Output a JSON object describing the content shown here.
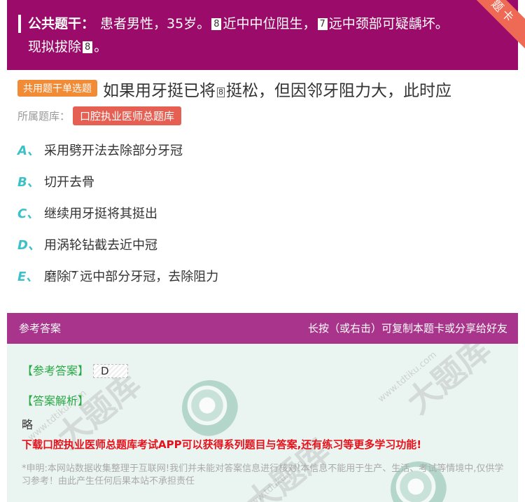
{
  "ribbon": {
    "label": "题卡"
  },
  "stem": {
    "label": "公共题干：",
    "line1_a": "患者男性，35岁。",
    "glyph_8": "8",
    "line1_b": "近中中位阻生，",
    "glyph_7": "7",
    "line1_c": "远中颈部可疑龋坏。",
    "line2_a": "现拟拔除",
    "line2_b": "。"
  },
  "question": {
    "tag": "共用题干单选题",
    "text_a": "如果用牙挺已将",
    "glyph": "8",
    "text_b": "挺松，但因邻牙阻力大，此时应"
  },
  "source": {
    "label": "所属题库：",
    "bank": "口腔执业医师总题库"
  },
  "options": [
    {
      "key": "A、",
      "text": "采用劈开法去除部分牙冠"
    },
    {
      "key": "B、",
      "text": "切开去骨"
    },
    {
      "key": "C、",
      "text": "继续用牙挺将其挺出"
    },
    {
      "key": "D、",
      "text": "用涡轮钻截去近中冠"
    },
    {
      "key": "E、",
      "text_a": "磨除",
      "glyph": "7",
      "text_b": "远中部分牙冠，去除阻力"
    }
  ],
  "answer_panel": {
    "title": "参考答案",
    "hint": "长按（或右击）可复制本题卡或分享给好友",
    "answer_label": "【参考答案】",
    "answer_value": "D",
    "analysis_label": "【答案解析】",
    "analysis_value": "略",
    "promo": "下载口腔执业医师总题库考试APP可以获得系列题目与答案,还有练习等更多学习功能!",
    "disclaimer": "*申明:本网站数据收集整理于互联网!我们并未能对答案信息进行核对!本信息不能用于生产、生活、考试等情境中,仅供学习参考！由此产生任何后果本站不承担责任"
  },
  "watermark": {
    "text": "大题库",
    "url": "www.tdtiku.com"
  }
}
